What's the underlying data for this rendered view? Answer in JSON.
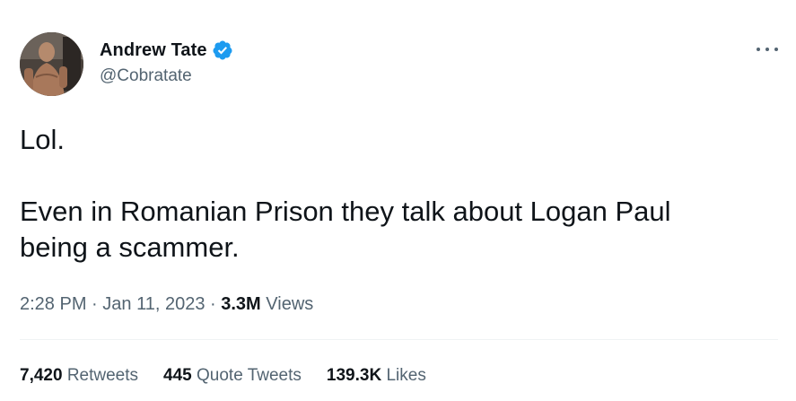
{
  "author": {
    "display_name": "Andrew Tate",
    "handle": "@Cobratate",
    "verified": true,
    "verified_color": "#1d9bf0"
  },
  "tweet": {
    "lines": [
      "Lol.",
      "Even in Romanian Prison they talk about Logan Paul being a scammer."
    ]
  },
  "meta": {
    "time": "2:28 PM",
    "separator": "·",
    "date": "Jan 11, 2023",
    "views_count": "3.3M",
    "views_label": "Views"
  },
  "stats": {
    "retweets_count": "7,420",
    "retweets_label": "Retweets",
    "quote_count": "445",
    "quote_label": "Quote Tweets",
    "likes_count": "139.3K",
    "likes_label": "Likes"
  },
  "icons": {
    "more": "more-options-icon",
    "verified": "verified-badge-icon"
  }
}
